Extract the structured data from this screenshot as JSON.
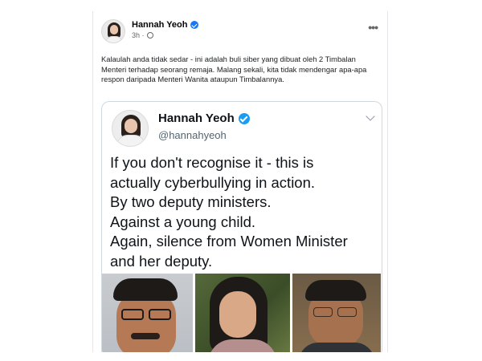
{
  "post": {
    "author": "Hannah Yeoh",
    "time": "3h",
    "text": "Kalaulah anda tidak sedar - ini adalah buli siber yang dibuat oleh 2 Timbalan Menteri terhadap seorang remaja. Malang sekali, kita tidak mendengar apa-apa respon daripada Menteri Wanita ataupun Timbalannya.",
    "more_icon": "more-horizontal-icon",
    "verified_icon": "verified-badge-icon",
    "privacy_icon": "globe-icon"
  },
  "tweet": {
    "name": "Hannah Yeoh",
    "handle": "@hannahyeoh",
    "lines": [
      "If you don't recognise it - this is",
      "actually cyberbullying in action.",
      "By two deputy ministers.",
      "Against a young child.",
      "Again, silence from Women Minister",
      "and her deputy."
    ],
    "menu_icon": "chevron-down-icon"
  },
  "colors": {
    "facebook_blue": "#1877f2",
    "twitter_blue": "#1d9bf0",
    "secondary_text": "#65676b",
    "tweet_border": "#cfd9de"
  }
}
